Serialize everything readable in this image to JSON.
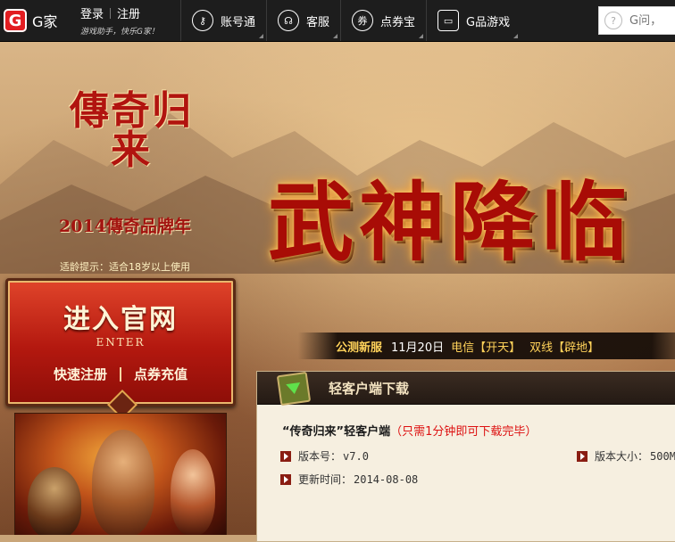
{
  "topbar": {
    "brand": "G家",
    "login": "登录",
    "register": "注册",
    "slogan": "游戏助手，快乐G家！",
    "nav": [
      {
        "label": "账号通"
      },
      {
        "label": "客服"
      },
      {
        "label": "点券宝"
      },
      {
        "label": "G品游戏"
      }
    ],
    "search_placeholder": "G问，"
  },
  "hero": {
    "game_title": "傳奇归来",
    "event_title": "2014傳奇品牌年",
    "age_tip": "适龄提示：适合18岁以上使用",
    "enter": {
      "title": "进入官网",
      "en": "ENTER",
      "quick_register": "快速注册",
      "recharge": "点券充值"
    },
    "banner_title": "武神降临",
    "announce": {
      "tag": "公测新服",
      "date": "11月20日",
      "line1": "电信【开天】",
      "line2": "双线【辟地】"
    }
  },
  "download": {
    "header": "轻客户端下载",
    "client_name": "“传奇归来”轻客户端",
    "client_note": "（只需1分钟即可下载完毕）",
    "version_label": "版本号：",
    "version_value": "v7.0",
    "size_label": "版本大小：",
    "size_value": "500M",
    "updated_label": "更新时间：",
    "updated_value": "2014-08-08"
  }
}
